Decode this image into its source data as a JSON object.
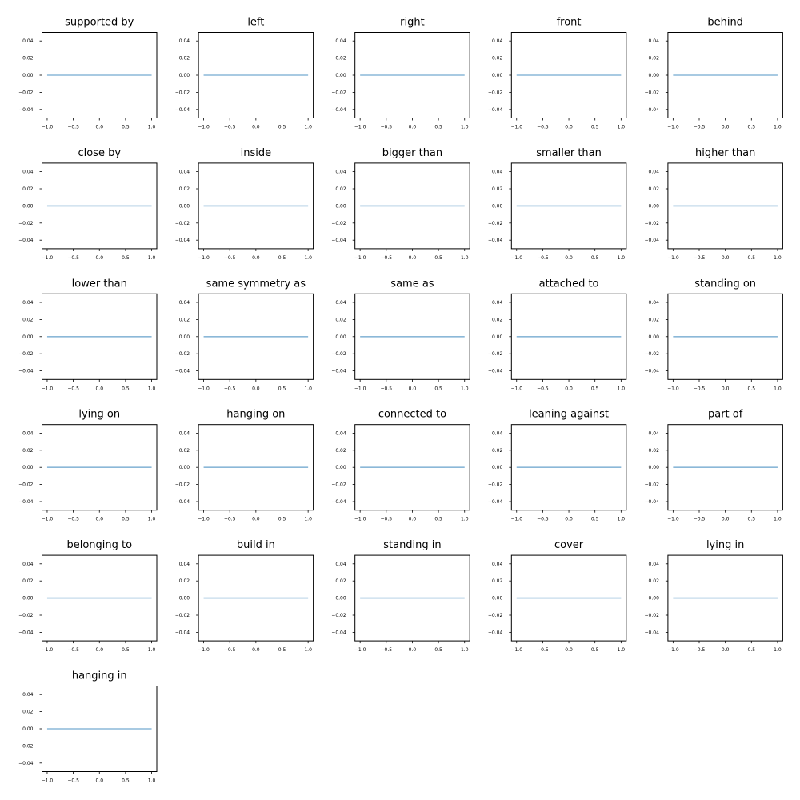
{
  "chart_data": {
    "type": "line",
    "layout": "grid",
    "columns": 5,
    "series_color": "#8bb8d8",
    "grid": false,
    "xlim": [
      -1.0,
      1.0
    ],
    "ylim": [
      -0.05,
      0.05
    ],
    "x_ticks": [
      "−1.0",
      "−0.5",
      "0.0",
      "0.5",
      "1.0"
    ],
    "x_tick_values": [
      -1.0,
      -0.5,
      0.0,
      0.5,
      1.0
    ],
    "y_ticks": [
      "0.04",
      "0.02",
      "0.00",
      "−0.02",
      "−0.04"
    ],
    "y_tick_values": [
      0.04,
      0.02,
      0.0,
      -0.02,
      -0.04
    ],
    "subplots": [
      {
        "title": "supported by",
        "x": [
          -1.0,
          1.0
        ],
        "y": [
          0,
          0
        ]
      },
      {
        "title": "left",
        "x": [
          -1.0,
          1.0
        ],
        "y": [
          0,
          0
        ]
      },
      {
        "title": "right",
        "x": [
          -1.0,
          1.0
        ],
        "y": [
          0,
          0
        ]
      },
      {
        "title": "front",
        "x": [
          -1.0,
          1.0
        ],
        "y": [
          0,
          0
        ]
      },
      {
        "title": "behind",
        "x": [
          -1.0,
          1.0
        ],
        "y": [
          0,
          0
        ]
      },
      {
        "title": "close by",
        "x": [
          -1.0,
          1.0
        ],
        "y": [
          0,
          0
        ]
      },
      {
        "title": "inside",
        "x": [
          -1.0,
          1.0
        ],
        "y": [
          0,
          0
        ]
      },
      {
        "title": "bigger than",
        "x": [
          -1.0,
          1.0
        ],
        "y": [
          0,
          0
        ]
      },
      {
        "title": "smaller than",
        "x": [
          -1.0,
          1.0
        ],
        "y": [
          0,
          0
        ]
      },
      {
        "title": "higher than",
        "x": [
          -1.0,
          1.0
        ],
        "y": [
          0,
          0
        ]
      },
      {
        "title": "lower than",
        "x": [
          -1.0,
          1.0
        ],
        "y": [
          0,
          0
        ]
      },
      {
        "title": "same symmetry as",
        "x": [
          -1.0,
          1.0
        ],
        "y": [
          0,
          0
        ]
      },
      {
        "title": "same as",
        "x": [
          -1.0,
          1.0
        ],
        "y": [
          0,
          0
        ]
      },
      {
        "title": "attached to",
        "x": [
          -1.0,
          1.0
        ],
        "y": [
          0,
          0
        ]
      },
      {
        "title": "standing on",
        "x": [
          -1.0,
          1.0
        ],
        "y": [
          0,
          0
        ]
      },
      {
        "title": "lying on",
        "x": [
          -1.0,
          1.0
        ],
        "y": [
          0,
          0
        ]
      },
      {
        "title": "hanging on",
        "x": [
          -1.0,
          1.0
        ],
        "y": [
          0,
          0
        ]
      },
      {
        "title": "connected to",
        "x": [
          -1.0,
          1.0
        ],
        "y": [
          0,
          0
        ]
      },
      {
        "title": "leaning against",
        "x": [
          -1.0,
          1.0
        ],
        "y": [
          0,
          0
        ]
      },
      {
        "title": "part of",
        "x": [
          -1.0,
          1.0
        ],
        "y": [
          0,
          0
        ]
      },
      {
        "title": "belonging to",
        "x": [
          -1.0,
          1.0
        ],
        "y": [
          0,
          0
        ]
      },
      {
        "title": "build in",
        "x": [
          -1.0,
          1.0
        ],
        "y": [
          0,
          0
        ]
      },
      {
        "title": "standing in",
        "x": [
          -1.0,
          1.0
        ],
        "y": [
          0,
          0
        ]
      },
      {
        "title": "cover",
        "x": [
          -1.0,
          1.0
        ],
        "y": [
          0,
          0
        ]
      },
      {
        "title": "lying in",
        "x": [
          -1.0,
          1.0
        ],
        "y": [
          0,
          0
        ]
      },
      {
        "title": "hanging in",
        "x": [
          -1.0,
          1.0
        ],
        "y": [
          0,
          0
        ]
      }
    ]
  }
}
